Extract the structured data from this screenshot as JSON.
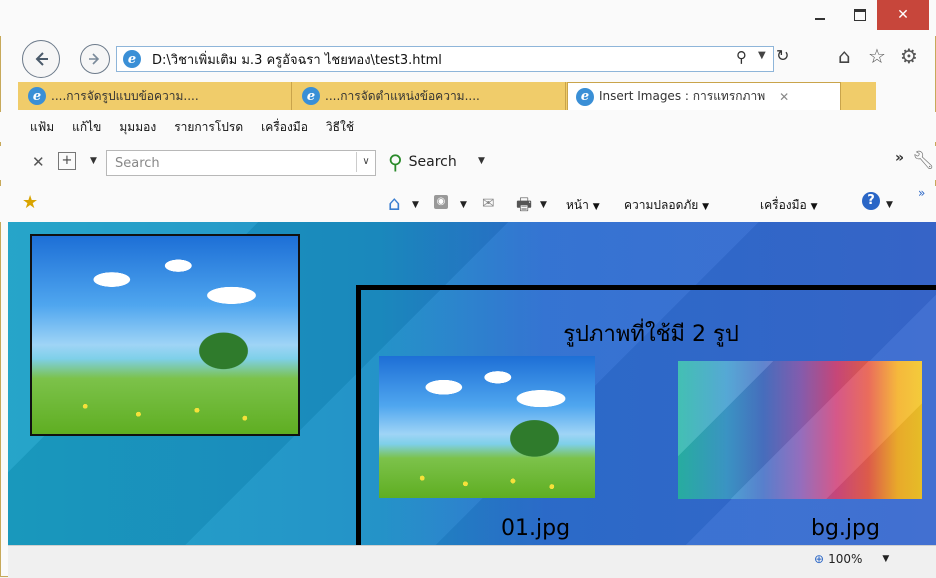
{
  "address": {
    "url": "D:\\วิชาเพิ่มเติม ม.3 ครูอัจฉรา ไชยทอง\\test3.html"
  },
  "tabs": [
    {
      "label": "....การจัดรูปแบบข้อความ...."
    },
    {
      "label": "....การจัดตำแหน่งข้อความ...."
    },
    {
      "label": "Insert Images : การแทรกภาพ"
    }
  ],
  "menu": {
    "items": [
      "แฟ้ม",
      "แก้ไข",
      "มุมมอง",
      "รายการโปรด",
      "เครื่องมือ",
      "วิธีใช้"
    ]
  },
  "search": {
    "placeholder": "Search",
    "button_label": "Search"
  },
  "commandbar": {
    "page": "หน้า",
    "safety": "ความปลอดภัย",
    "tools": "เครื่องมือ"
  },
  "content": {
    "heading": "รูปภาพที่ใช้มี 2 รูป",
    "images": [
      {
        "caption": "01.jpg"
      },
      {
        "caption": "bg.jpg"
      }
    ]
  },
  "status": {
    "zoom": "100%"
  },
  "colors": {
    "tab_bg": "#f0cc6a",
    "close_button": "#c7463b",
    "page_bg": "#1b8fc6"
  },
  "icons": [
    "back-icon",
    "forward-icon",
    "ie-page-icon",
    "search-icon",
    "refresh-icon",
    "home-icon",
    "favorites-icon",
    "gear-icon",
    "add-favorites-icon",
    "feeds-icon",
    "mail-icon",
    "print-icon",
    "help-icon",
    "wrench-icon",
    "zoom-icon"
  ]
}
